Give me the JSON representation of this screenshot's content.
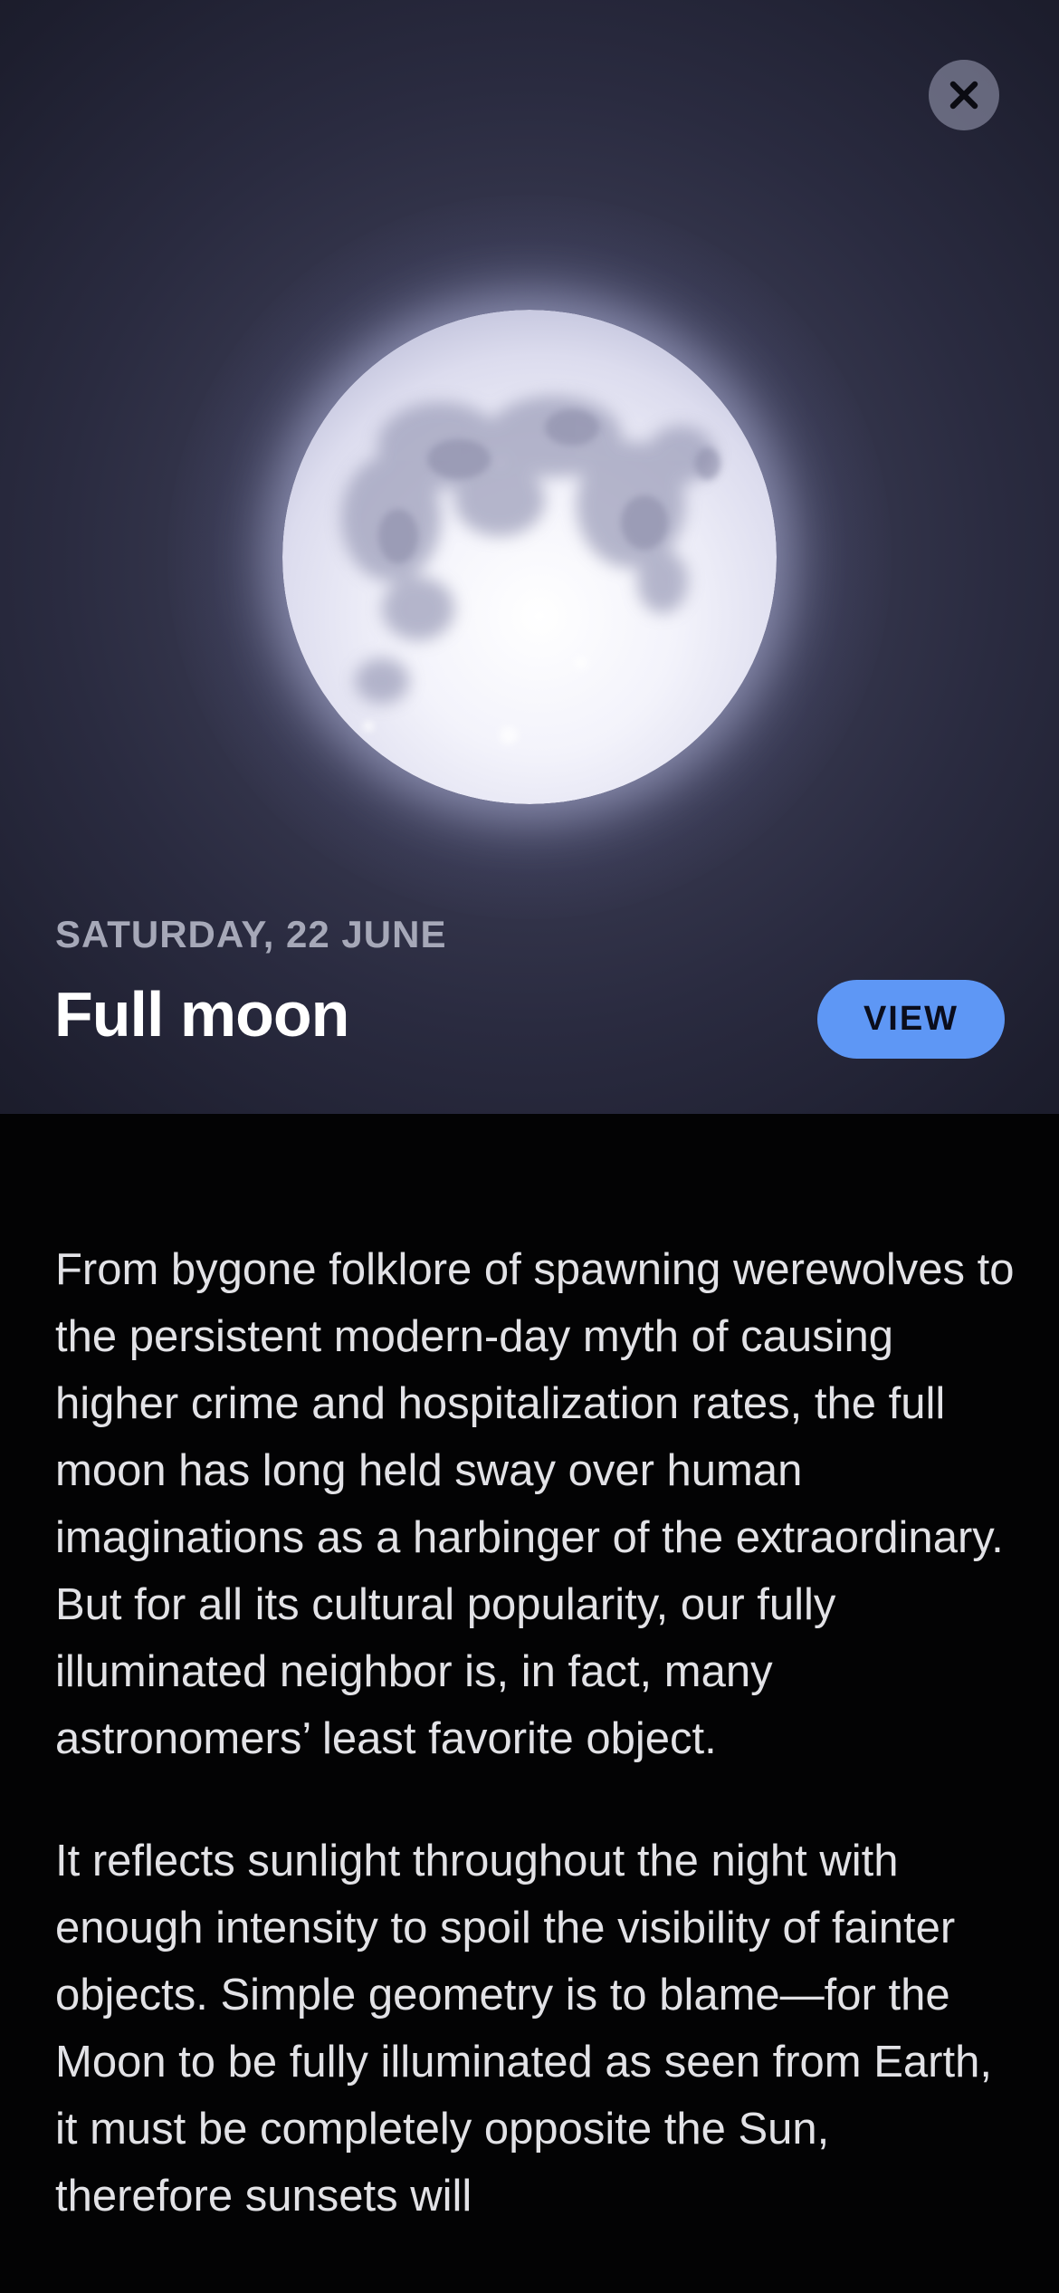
{
  "event": {
    "date": "SATURDAY, 22 JUNE",
    "title": "Full moon",
    "view_label": "VIEW"
  },
  "icons": {
    "close": "close-icon",
    "moon": "moon-image"
  },
  "colors": {
    "accent_button": "#5e97f5",
    "hero_background": "#2a2b40",
    "page_background": "#030304",
    "body_text": "#e2e2e6",
    "date_text": "#a6a8b8"
  },
  "article": {
    "paragraphs": [
      "From bygone folklore of spawning werewolves to the persistent modern-day myth of causing higher crime and hospitalization rates, the full moon has long held sway over human imaginations as a harbinger of the extraordinary. But for all its cultural popularity, our fully illuminated neighbor is, in fact, many astronomers’ least favorite object.",
      "It reflects sunlight throughout the night with enough intensity to spoil the visibility of fainter objects. Simple geometry is to blame—for the Moon to be fully illuminated as seen from Earth, it must be completely opposite the Sun, therefore sunsets will"
    ]
  }
}
